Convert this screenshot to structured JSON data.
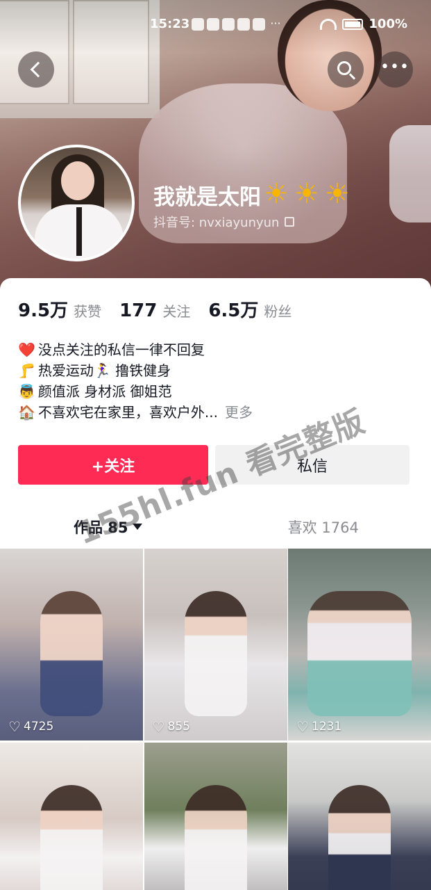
{
  "status_bar": {
    "time": "15:23",
    "battery": "100%"
  },
  "header": {
    "nickname": "我就是太阳",
    "nickname_emoji": [
      "sun",
      "sun",
      "sun"
    ],
    "account_label": "抖音号: nvxiayunyun"
  },
  "stats": [
    {
      "num": "9.5万",
      "label": "获赞"
    },
    {
      "num": "177",
      "label": "关注"
    },
    {
      "num": "6.5万",
      "label": "粉丝"
    }
  ],
  "bio": {
    "lines": [
      {
        "emoji": "❤️",
        "text": "没点关注的私信一律不回复"
      },
      {
        "emoji": "🦵",
        "text": "热爱运动🏃‍♀️ 撸铁健身"
      },
      {
        "emoji": "👼",
        "text": "颜值派 身材派 御姐范"
      },
      {
        "emoji": "🏠",
        "text": "不喜欢宅在家里，喜欢户外..."
      }
    ],
    "more": "更多"
  },
  "actions": {
    "follow": "+关注",
    "message": "私信"
  },
  "tabs": {
    "works": "作品 85",
    "likes": "喜欢 1764"
  },
  "watermark": "155hl.fun 看完整版",
  "videos": [
    {
      "likes": "4725"
    },
    {
      "likes": "855"
    },
    {
      "likes": "1231"
    },
    {
      "likes": ""
    },
    {
      "likes": ""
    },
    {
      "likes": ""
    }
  ],
  "colors": {
    "follow_button": "#fe2c55",
    "message_button": "#f1f1f2",
    "text_primary": "#161823",
    "text_secondary": "#8a8b91"
  }
}
